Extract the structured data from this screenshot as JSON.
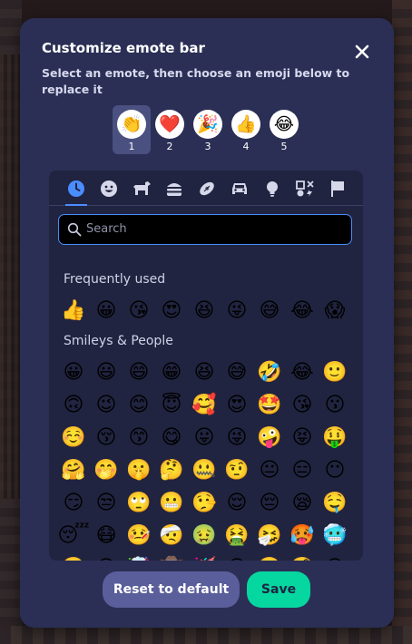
{
  "dialog": {
    "title": "Customize emote bar",
    "subtitle": "Select an emote, then choose an emoji below to replace it",
    "close_icon": "close-icon"
  },
  "emote_slots": [
    {
      "number": "1",
      "emoji": "👏",
      "selected": true
    },
    {
      "number": "2",
      "emoji": "❤️",
      "selected": false
    },
    {
      "number": "3",
      "emoji": "🎉",
      "selected": false
    },
    {
      "number": "4",
      "emoji": "👍",
      "selected": false
    },
    {
      "number": "5",
      "emoji": "😂",
      "selected": false
    }
  ],
  "category_tabs": [
    {
      "name": "recent",
      "icon": "clock-icon",
      "active": true
    },
    {
      "name": "smileys",
      "icon": "smiley-icon",
      "active": false
    },
    {
      "name": "animals",
      "icon": "dog-icon",
      "active": false
    },
    {
      "name": "food",
      "icon": "burger-icon",
      "active": false
    },
    {
      "name": "activities",
      "icon": "football-icon",
      "active": false
    },
    {
      "name": "travel",
      "icon": "car-icon",
      "active": false
    },
    {
      "name": "objects",
      "icon": "lightbulb-icon",
      "active": false
    },
    {
      "name": "symbols",
      "icon": "symbols-icon",
      "active": false
    },
    {
      "name": "flags",
      "icon": "flag-icon",
      "active": false
    }
  ],
  "search": {
    "placeholder": "Search",
    "value": ""
  },
  "sections": {
    "frequently_used": {
      "label": "Frequently used",
      "emojis": [
        "👍",
        "😀",
        "😘",
        "😍",
        "😆",
        "😜",
        "😅",
        "😂",
        "😱"
      ]
    },
    "smileys_people": {
      "label": "Smileys & People",
      "emojis": [
        "😀",
        "😃",
        "😄",
        "😁",
        "😆",
        "😅",
        "🤣",
        "😂",
        "🙂",
        "🙃",
        "😉",
        "😊",
        "😇",
        "🥰",
        "😍",
        "🤩",
        "😘",
        "😗",
        "☺️",
        "😚",
        "😙",
        "😋",
        "😛",
        "😜",
        "🤪",
        "😝",
        "🤑",
        "🤗",
        "🤭",
        "🤫",
        "🤔",
        "🤐",
        "🤨",
        "😐",
        "😑",
        "😶",
        "😏",
        "😒",
        "🙄",
        "😬",
        "🤥",
        "😌",
        "😔",
        "😪",
        "🤤",
        "😴",
        "😷",
        "🤒",
        "🤕",
        "🤢",
        "🤮",
        "🤧",
        "🥵",
        "🥶",
        "🥴",
        "😵",
        "🤯",
        "🤠",
        "🥳",
        "😎",
        "🤓",
        "🧐",
        "😕"
      ]
    }
  },
  "actions": {
    "reset_label": "Reset to default",
    "save_label": "Save"
  },
  "colors": {
    "dialog_bg": "#2b2f55",
    "picker_bg": "#202440",
    "accent_blue": "#4a8dff",
    "save_green": "#06d6a0",
    "reset_purple": "#5a5e9a"
  }
}
